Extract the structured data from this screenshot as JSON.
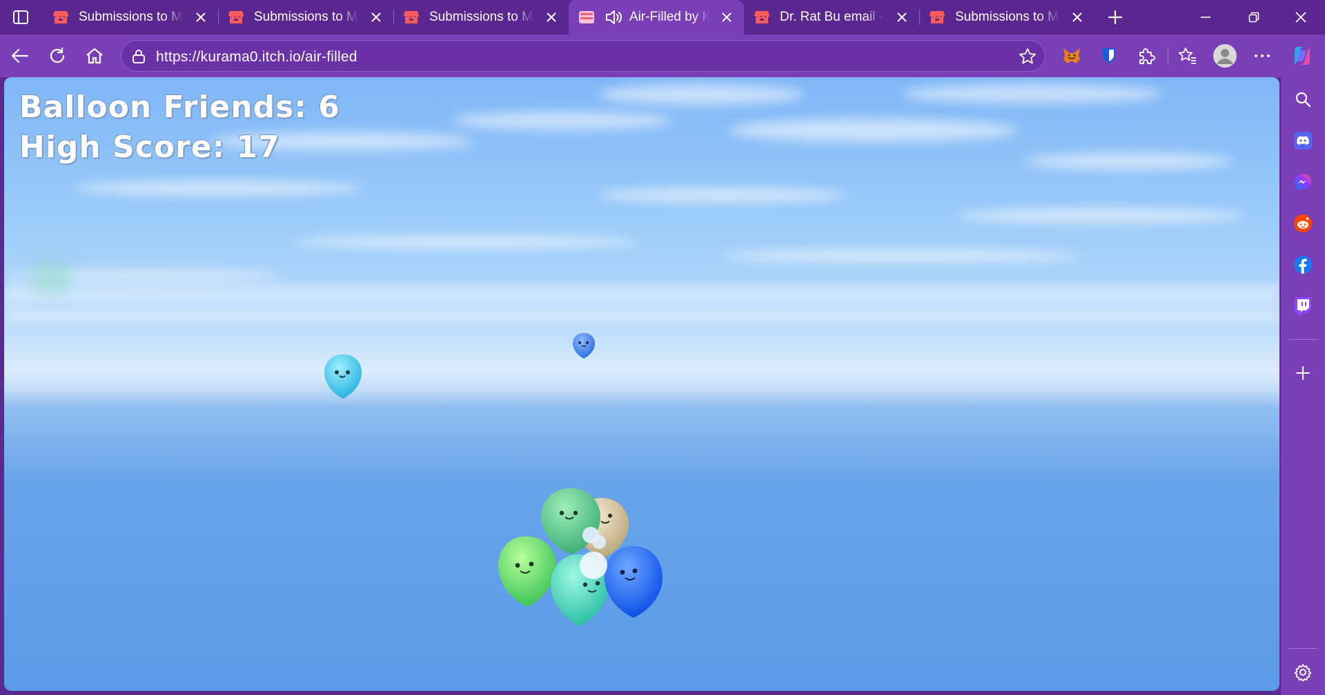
{
  "browser": {
    "tabs": [
      {
        "title": "Submissions to Mini",
        "active": false,
        "audio": false
      },
      {
        "title": "Submissions to Mini",
        "active": false,
        "audio": false
      },
      {
        "title": "Submissions to Mini",
        "active": false,
        "audio": false
      },
      {
        "title": "Air-Filled by KU",
        "active": true,
        "audio": true
      },
      {
        "title": "Dr. Rat Bu email - itc",
        "active": false,
        "audio": false
      },
      {
        "title": "Submissions to Mini",
        "active": false,
        "audio": false
      }
    ],
    "url": "https://kurama0.itch.io/air-filled",
    "colors": {
      "frame": "#5a2690",
      "toolbar": "#7a3fb6",
      "itch_red": "#fa5c5c"
    }
  },
  "game": {
    "title": "Air-Filled",
    "balloon_friends_label": "Balloon Friends: 6",
    "high_score_label": "High Score: 17",
    "balloon_friends": 6,
    "high_score": 17,
    "balloon_colors": [
      "#3fc6e8",
      "#2f7be6",
      "#4ed08a",
      "#d9c79a",
      "#5fe07a",
      "#3fd6b8",
      "#1a63ff"
    ]
  },
  "sidebar_icons": [
    "search-icon",
    "discord-icon",
    "messenger-icon",
    "reddit-icon",
    "facebook-icon",
    "twitch-icon",
    "add-icon",
    "settings-icon"
  ]
}
